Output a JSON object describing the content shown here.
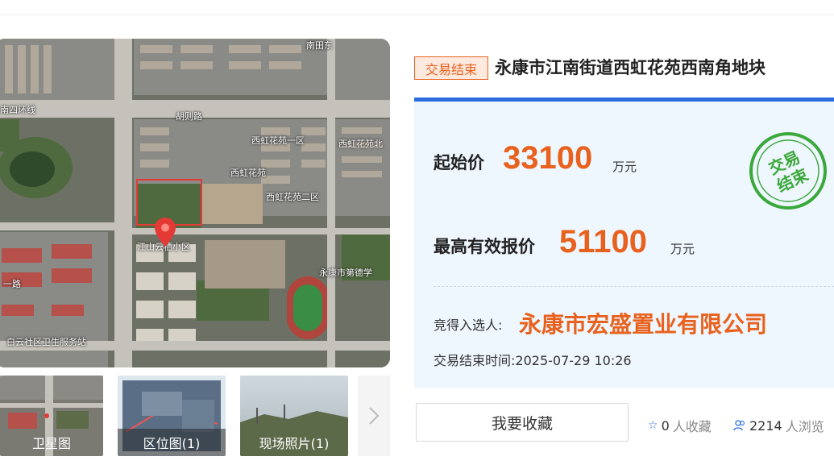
{
  "map": {
    "labels": [
      {
        "text": "南四环线"
      },
      {
        "text": "胡则路"
      },
      {
        "text": "西虹花苑一区"
      },
      {
        "text": "西虹花苑"
      },
      {
        "text": "西虹花苑二区"
      },
      {
        "text": "西虹花苑北"
      },
      {
        "text": "江山云栖小区"
      },
      {
        "text": "永康市第德学"
      },
      {
        "text": "白云社区卫生服务站"
      },
      {
        "text": "一路"
      },
      {
        "text": "南田东"
      }
    ]
  },
  "thumbs": [
    {
      "label": "卫星图"
    },
    {
      "label": "区位图(1)"
    },
    {
      "label": "现场照片(1)"
    }
  ],
  "status_tag": "交易结束",
  "title": "永康市江南街道西虹花苑西南角地块",
  "start_price": {
    "label": "起始价",
    "value": "33100",
    "unit": "万元"
  },
  "max_bid": {
    "label": "最高有效报价",
    "value": "51100",
    "unit": "万元"
  },
  "stamp": {
    "line1": "交易",
    "line2": "结束"
  },
  "winner": {
    "label": "竞得入选人:",
    "name": "永康市宏盛置业有限公司"
  },
  "end_time": {
    "label": "交易结束时间:",
    "value": "2025-07-29 10:26"
  },
  "actions": {
    "favorite_button": "我要收藏",
    "favorites": {
      "count": "0",
      "suffix": "人收藏"
    },
    "views": {
      "count": "2214",
      "suffix": "人浏览"
    }
  },
  "colors": {
    "accent": "#e8621e",
    "brand_blue": "#2b6de0",
    "stamp_green": "#3aa83a"
  }
}
